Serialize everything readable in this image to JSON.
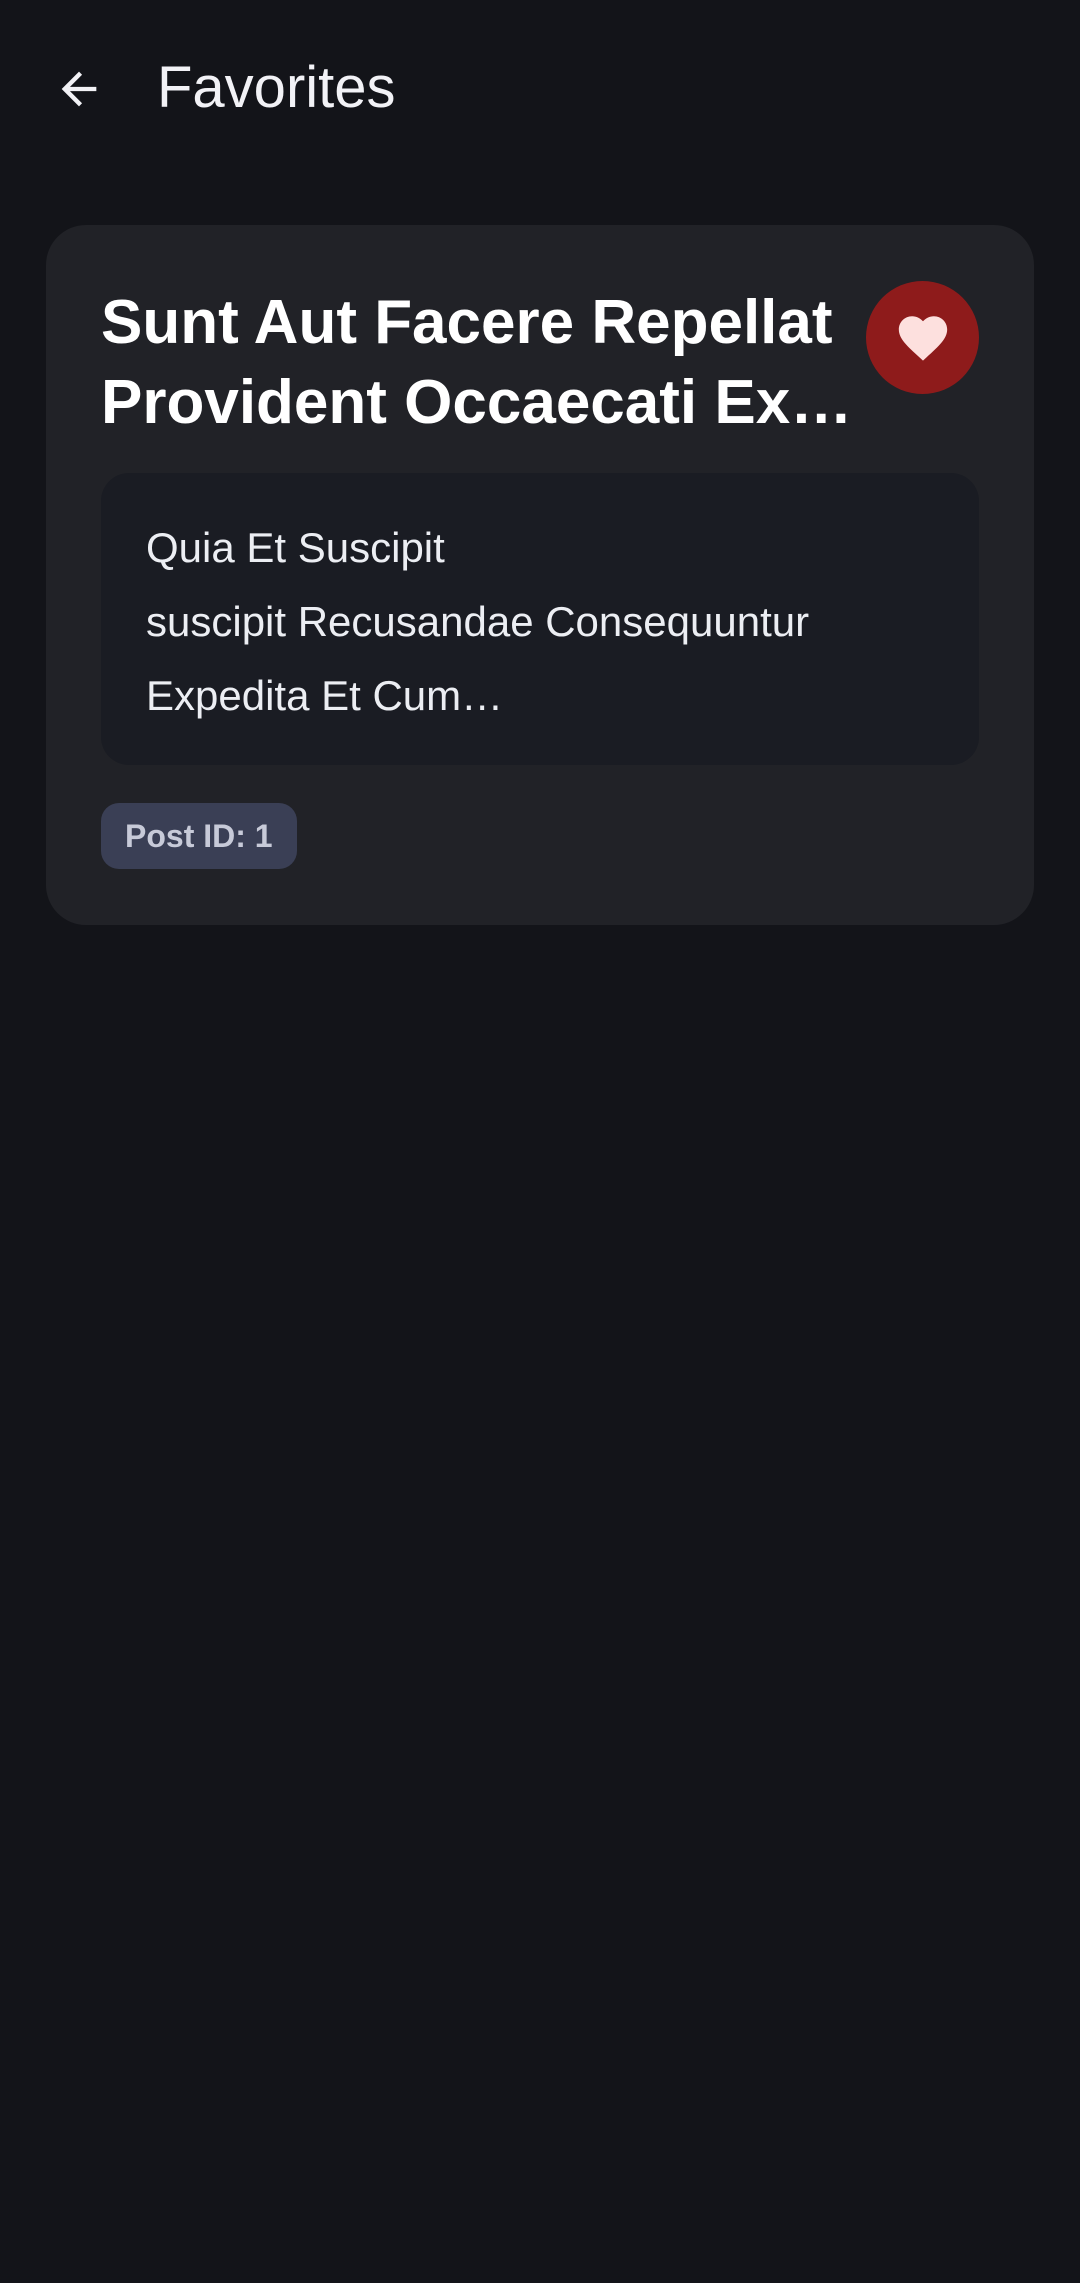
{
  "app_bar": {
    "back_icon": "arrow-left-icon",
    "title": "Favorites"
  },
  "post": {
    "title": "Sunt Aut Facere Repellat Provident Occaecati Ex…",
    "favorite_icon": "heart-icon",
    "favorited": true,
    "body": "Quia Et Suscipit\nsuscipit Recusandae Consequuntur Expedita Et Cum…",
    "badge": "Post ID: 1"
  },
  "colors": {
    "background": "#131419",
    "card": "#212227",
    "body_box": "#1a1c23",
    "favorite_active": "#8e1b1b",
    "heart": "#fde0de",
    "badge_bg": "#3a3f55",
    "badge_text": "#c7cad8"
  }
}
